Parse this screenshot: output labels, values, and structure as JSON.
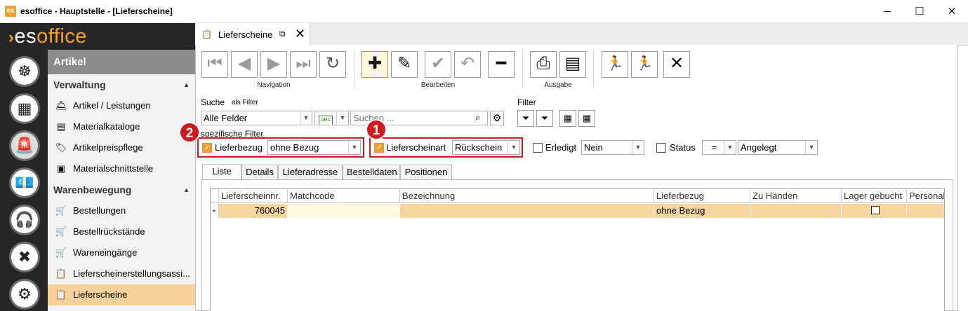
{
  "window": {
    "title": "esoffice - Hauptstelle - [Lieferscheine]",
    "app_icon": "esoffice-app-icon",
    "minimize": "─",
    "maximize": "☐",
    "close": "✕"
  },
  "logo": {
    "prefix": "es",
    "suffix": "office"
  },
  "nav_icons": [
    "helm-icon",
    "catalog-icon",
    "alarm-icon",
    "money-icon",
    "headset-icon",
    "tools-icon",
    "gears-icon"
  ],
  "sidebar": {
    "header": "Artikel",
    "sections": [
      {
        "title": "Verwaltung",
        "items": [
          {
            "label": "Artikel / Leistungen",
            "icon": "article-icon"
          },
          {
            "label": "Materialkataloge",
            "icon": "catalog-icon"
          },
          {
            "label": "Artikelpreispflege",
            "icon": "price-icon"
          },
          {
            "label": "Materialschnittstelle",
            "icon": "interface-icon"
          }
        ]
      },
      {
        "title": "Warenbewegung",
        "items": [
          {
            "label": "Bestellungen",
            "icon": "cart-icon"
          },
          {
            "label": "Bestellrückstände",
            "icon": "cart-alert-icon"
          },
          {
            "label": "Wareneingänge",
            "icon": "cart-in-icon"
          },
          {
            "label": "Lieferscheinerstellungsassi...",
            "icon": "delivery-wizard-icon"
          },
          {
            "label": "Lieferscheine",
            "icon": "delivery-note-icon",
            "active": true
          }
        ]
      }
    ]
  },
  "doc_tab": {
    "label": "Lieferscheine",
    "popout": "⧉",
    "close": "✕"
  },
  "toolbar": {
    "groups": [
      {
        "label": "Navigation"
      },
      {
        "label": "Bearbeiten"
      },
      {
        "label": "Ausgabe"
      }
    ],
    "buttons": [
      {
        "name": "first-record",
        "glyph": "⏮",
        "enabled": false
      },
      {
        "name": "previous-record",
        "glyph": "◀",
        "enabled": false
      },
      {
        "name": "next-record",
        "glyph": "▶",
        "enabled": false
      },
      {
        "name": "last-record",
        "glyph": "⏭",
        "enabled": false
      },
      {
        "name": "refresh",
        "glyph": "↻",
        "enabled": true
      },
      {
        "name": "new",
        "glyph": "✚",
        "enabled": true
      },
      {
        "name": "edit",
        "glyph": "✎",
        "enabled": true
      },
      {
        "name": "save",
        "glyph": "✔",
        "enabled": false
      },
      {
        "name": "undo",
        "glyph": "↶",
        "enabled": false
      },
      {
        "name": "delete",
        "glyph": "━",
        "enabled": true
      },
      {
        "name": "print",
        "glyph": "⎙",
        "enabled": true
      },
      {
        "name": "export",
        "glyph": "▤",
        "enabled": true
      },
      {
        "name": "run-slow",
        "glyph": "🏃",
        "enabled": true
      },
      {
        "name": "run-fast",
        "glyph": "🏃",
        "enabled": true
      },
      {
        "name": "close-view",
        "glyph": "✕",
        "enabled": true
      }
    ]
  },
  "search": {
    "label": "Suche",
    "as_filter": "als Filter",
    "field_value": "Alle Felder",
    "placeholder": "Suchen ...",
    "abc_label": "ABC"
  },
  "filter": {
    "label": "Filter"
  },
  "specific_filters": {
    "label": "spezifische Filter",
    "lieferbezug": {
      "label": "Lieferbezug",
      "checked": true,
      "value": "ohne Bezug"
    },
    "lieferscheinart": {
      "label": "Lieferscheinart",
      "checked": true,
      "value": "Rückschein"
    },
    "erledigt": {
      "label": "Erledigt",
      "checked": false,
      "value": "Nein"
    },
    "status": {
      "label": "Status",
      "checked": false,
      "operator": "=",
      "value": "Angelegt"
    }
  },
  "badges": {
    "one": "1",
    "two": "2"
  },
  "subtabs": [
    "Liste",
    "Details",
    "Lieferadresse",
    "Bestelldaten",
    "Positionen"
  ],
  "grid": {
    "columns": [
      "Lieferscheinnr.",
      "Matchcode",
      "Bezeichnung",
      "Lieferbezug",
      "Zu Händen",
      "Lager gebucht",
      "Personal"
    ],
    "rows": [
      {
        "lieferscheinnr": "760045",
        "matchcode": "",
        "bezeichnung": "",
        "lieferbezug": "ohne Bezug",
        "zu_haenden": "",
        "lager_gebucht": false,
        "personal": ""
      }
    ]
  }
}
